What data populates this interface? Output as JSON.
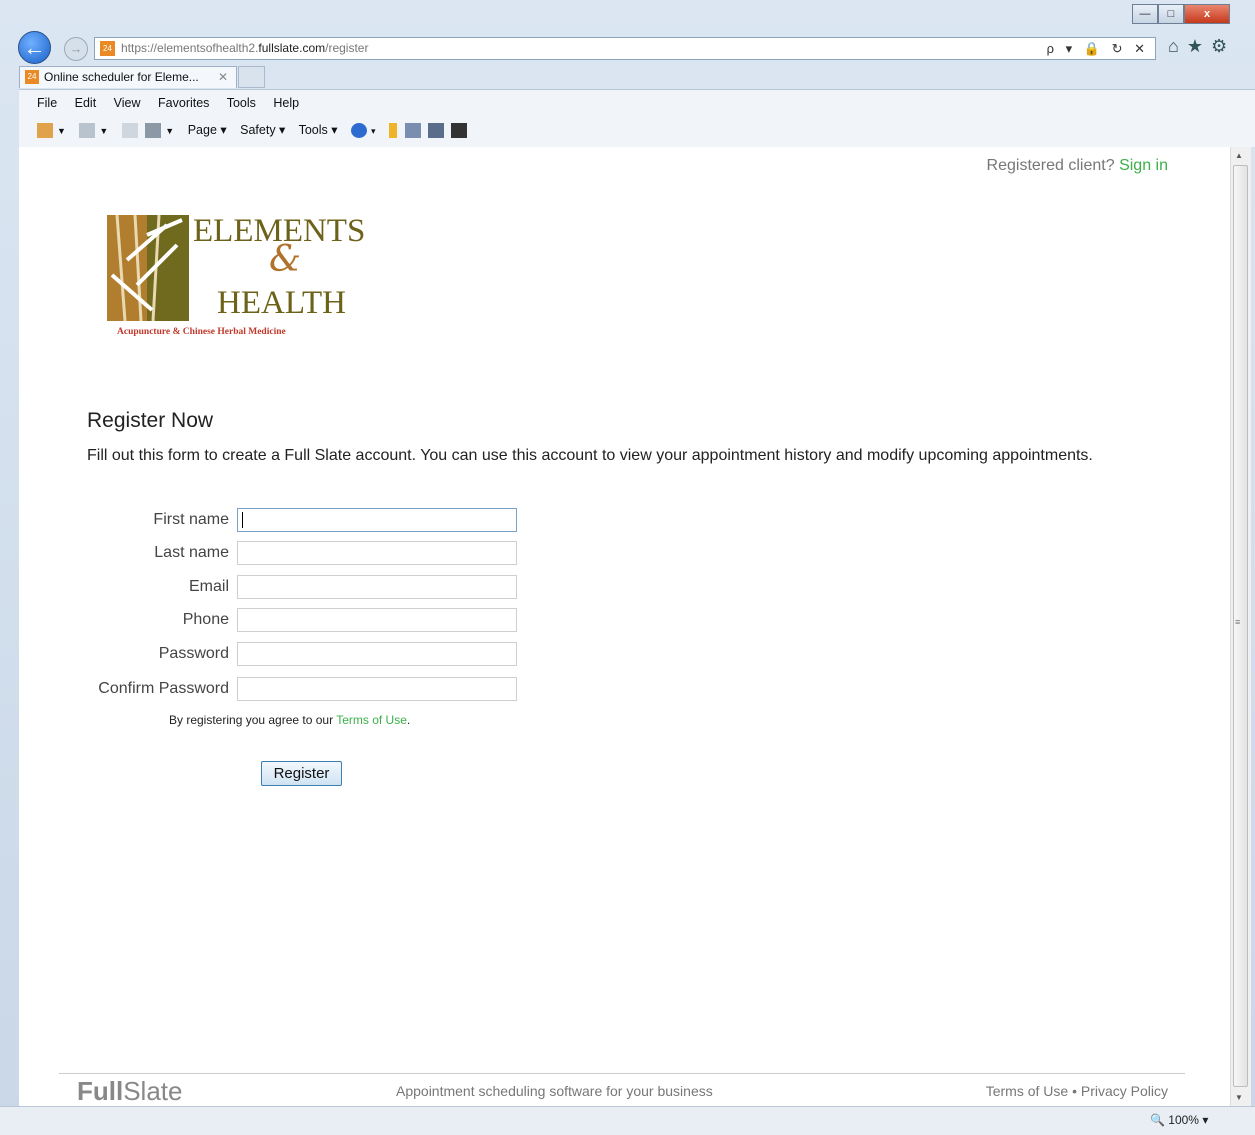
{
  "browser": {
    "window_controls": {
      "minimize": "—",
      "maximize": "□",
      "close": "x"
    },
    "address": {
      "prefix": "https://elementsofhealth2.",
      "domain": "fullslate.com",
      "path": "/register",
      "tools": "ρ ▾ 🔒 ↻ ✕"
    },
    "right_icons": "⌂★⚙",
    "tab": {
      "title": "Online scheduler for Eleme...",
      "close": "✕"
    },
    "menu": [
      "File",
      "Edit",
      "View",
      "Favorites",
      "Tools",
      "Help"
    ],
    "commands": {
      "page": "Page",
      "safety": "Safety",
      "tools": "Tools"
    },
    "zoom": "100%"
  },
  "header": {
    "prompt": "Registered client?",
    "signin": "Sign in"
  },
  "logo": {
    "line1": "ELEMENTS",
    "amp": "&",
    "line2": "HEALTH",
    "tagline": "Acupuncture & Chinese Herbal Medicine"
  },
  "form": {
    "title": "Register Now",
    "intro": "Fill out this form to create a Full Slate account. You can use this account to view your appointment history and modify upcoming appointments.",
    "fields": [
      "First name",
      "Last name",
      "Email",
      "Phone",
      "Password",
      "Confirm Password"
    ],
    "agree_prefix": "By registering you agree to our",
    "terms_link": "Terms of Use",
    "submit": "Register"
  },
  "footer": {
    "brand_bold": "Full",
    "brand_light": "Slate",
    "tagline": "Appointment scheduling software for your business",
    "terms": "Terms of Use",
    "sep": "•",
    "privacy": "Privacy Policy"
  }
}
